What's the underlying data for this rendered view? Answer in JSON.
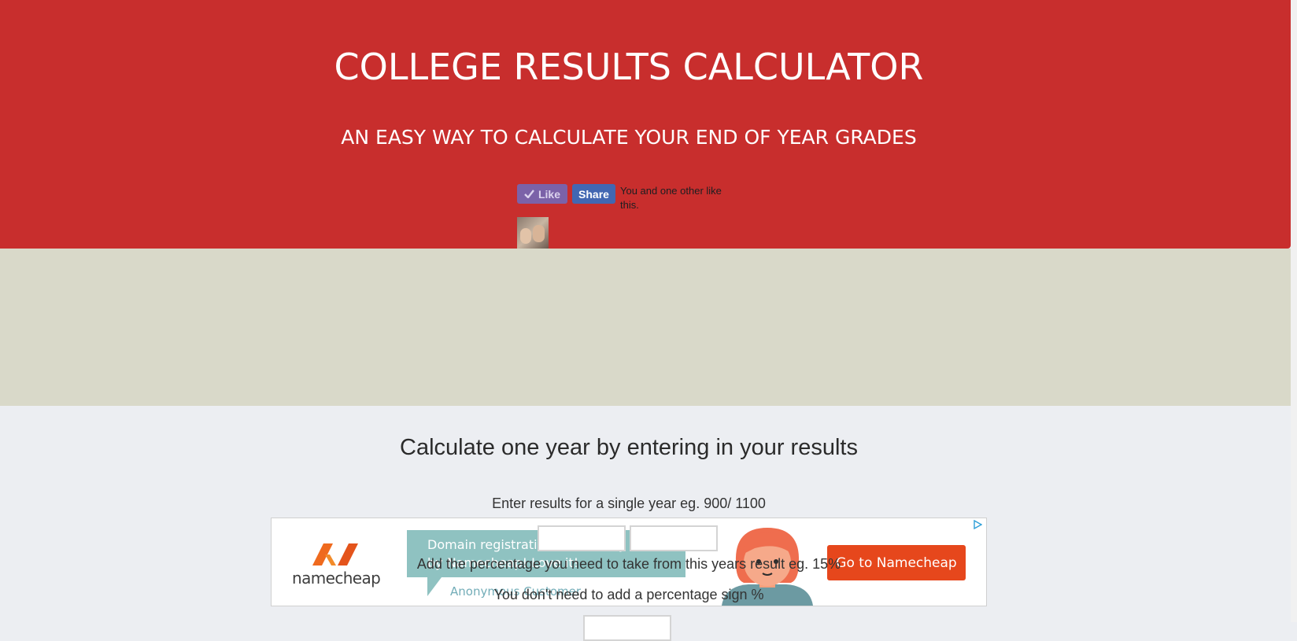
{
  "hero": {
    "title": "COLLEGE RESULTS CALCULATOR",
    "subtitle": "AN EASY WAY TO CALCULATE YOUR END OF YEAR GRADES",
    "like_label": "Like",
    "share_label": "Share",
    "social_text": "You and one other like this."
  },
  "ad": {
    "brand": "namecheap",
    "quote": "Domain registration made easy as cake by Namecheap! Love it!",
    "attribution": "Anonymous Customer",
    "cta_label": "Go to Namecheap",
    "colors": {
      "accent": "#e6471c",
      "bubble": "#8fc2c1"
    }
  },
  "calculator": {
    "title": "Calculate one year by entering in your results",
    "results_instruction": "Enter results for a single year eg. 900/ 1100",
    "percent_instruction": "Add the percentage you need to take from this years result eg. 15%",
    "percent_note": "You don't need to add a percentage sign %",
    "score_value": "",
    "total_value": "",
    "percent_value": ""
  },
  "colors": {
    "hero": "#c82e2d",
    "band": "#d9d9c9",
    "page": "#eceef2"
  }
}
